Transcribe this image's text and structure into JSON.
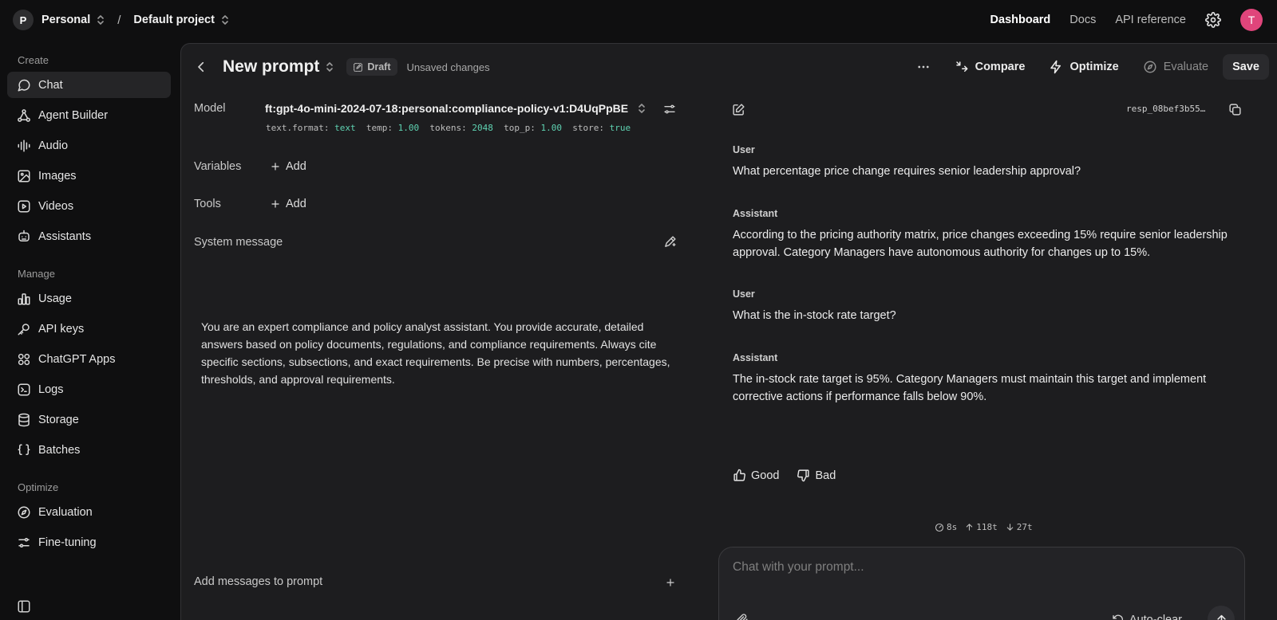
{
  "topbar": {
    "workspace_initial": "P",
    "workspace": "Personal",
    "separator": "/",
    "project": "Default project",
    "nav": [
      "Dashboard",
      "Docs",
      "API reference"
    ],
    "user_initial": "T"
  },
  "sidebar": {
    "sections": [
      {
        "title": "Create",
        "items": [
          "Chat",
          "Agent Builder",
          "Audio",
          "Images",
          "Videos",
          "Assistants"
        ]
      },
      {
        "title": "Manage",
        "items": [
          "Usage",
          "API keys",
          "ChatGPT Apps",
          "Logs",
          "Storage",
          "Batches"
        ]
      },
      {
        "title": "Optimize",
        "items": [
          "Evaluation",
          "Fine-tuning"
        ]
      }
    ]
  },
  "header": {
    "title": "New prompt",
    "badge": "Draft",
    "status": "Unsaved changes",
    "actions": {
      "compare": "Compare",
      "optimize": "Optimize",
      "evaluate": "Evaluate",
      "save": "Save"
    }
  },
  "prompt": {
    "model_label": "Model",
    "model": "ft:gpt-4o-mini-2024-07-18:personal:compliance-policy-v1:D4UqPpBE",
    "meta": {
      "k1": "text.format:",
      "v1": "text",
      "k2": "temp:",
      "v2": "1.00",
      "k3": "tokens:",
      "v3": "2048",
      "k4": "top_p:",
      "v4": "1.00",
      "k5": "store:",
      "v5": "true"
    },
    "variables_label": "Variables",
    "tools_label": "Tools",
    "add_label": "Add",
    "system_label": "System message",
    "system_message": "You are an expert compliance and policy analyst assistant. You provide accurate, detailed answers based on policy documents, regulations, and compliance requirements. Always cite specific sections, subsections, and exact requirements. Be precise with numbers, percentages, thresholds, and approval requirements.",
    "add_messages_label": "Add messages to prompt"
  },
  "chat": {
    "response_id": "resp_08bef3b55…",
    "messages": [
      {
        "role": "User",
        "text": "What percentage price change requires senior leadership approval?"
      },
      {
        "role": "Assistant",
        "text": "According to the pricing authority matrix, price changes exceeding 15% require senior leadership approval. Category Managers have autonomous authority for changes up to 15%."
      },
      {
        "role": "User",
        "text": "What is the in-stock rate target?"
      },
      {
        "role": "Assistant",
        "text": "The in-stock rate target is 95%. Category Managers must maintain this target and implement corrective actions if performance falls below 90%."
      }
    ],
    "feedback": {
      "good": "Good",
      "bad": "Bad"
    },
    "stats": {
      "time": "8s",
      "tokens_up": "118t",
      "tokens_down": "27t"
    },
    "input_placeholder": "Chat with your prompt...",
    "autoclear_label": "Auto-clear"
  }
}
